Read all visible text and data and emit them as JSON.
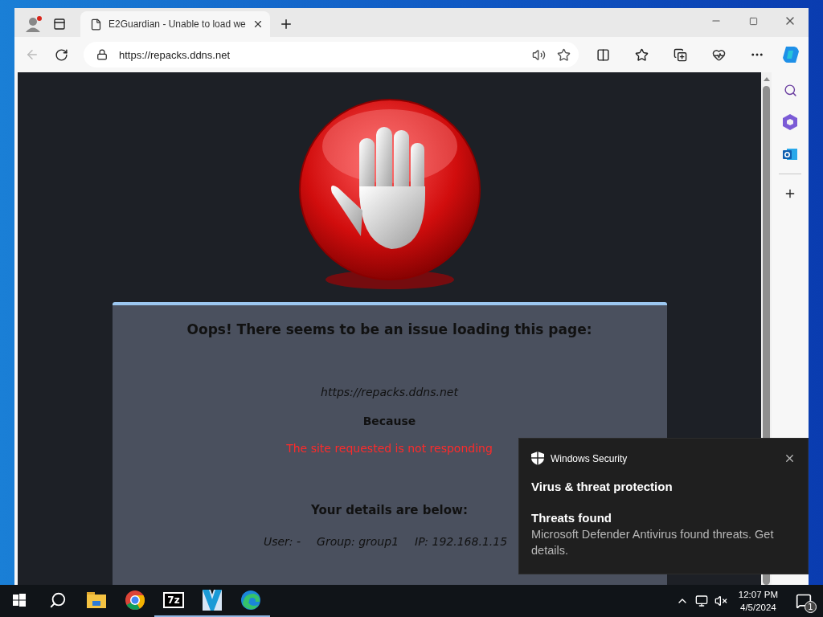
{
  "browser": {
    "tab": {
      "title": "E2Guardian - Unable to load we",
      "selected": true
    },
    "address": "https://repacks.ddns.net",
    "profile_alert": true
  },
  "page": {
    "heading": "Oops! There seems to be an issue loading this page:",
    "url": "https://repacks.ddns.net",
    "because": "Because",
    "reason": "The site requested is not responding",
    "details_heading": "Your details are below:",
    "details": [
      "User: -",
      "Group: group1",
      "IP: 192.168.1.15"
    ]
  },
  "notification": {
    "app": "Windows Security",
    "title": "Virus & threat protection",
    "heading": "Threats found",
    "body": "Microsoft Defender Antivirus found threats. Get details."
  },
  "taskbar": {
    "apps": [
      {
        "kind": "explorer",
        "running": false
      },
      {
        "kind": "chrome",
        "running": false
      },
      {
        "kind": "archiver",
        "label": "7z",
        "running": true
      },
      {
        "kind": "video",
        "running": true
      },
      {
        "kind": "edge",
        "running": true
      }
    ],
    "time": "12:07 PM",
    "date": "4/5/2024",
    "notification_count": "1"
  }
}
